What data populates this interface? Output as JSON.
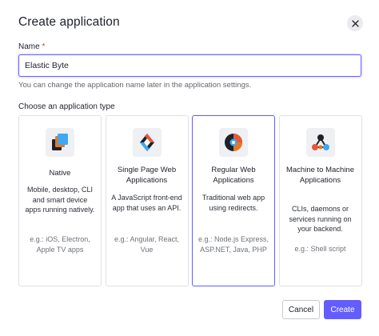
{
  "dialog": {
    "title": "Create application",
    "close_icon": "close-icon"
  },
  "name_field": {
    "label": "Name",
    "required_marker": "*",
    "value": "Elastic Byte",
    "helper": "You can change the application name later in the application settings."
  },
  "app_type": {
    "label": "Choose an application type",
    "selected": "Regular Web Applications",
    "options": [
      {
        "icon": "native-app-icon",
        "title": "Native",
        "description": "Mobile, desktop, CLI and smart device apps running natively.",
        "examples": "e.g.: iOS, Electron, Apple TV apps"
      },
      {
        "icon": "spa-icon",
        "title": "Single Page Web Applications",
        "description": "A JavaScript front-end app that uses an API.",
        "examples": "e.g.: Angular, React, Vue"
      },
      {
        "icon": "regular-web-app-icon",
        "title": "Regular Web Applications",
        "description": "Traditional web app using redirects.",
        "examples": "e.g.: Node.js Express, ASP.NET, Java, PHP"
      },
      {
        "icon": "m2m-icon",
        "title": "Machine to Machine Applications",
        "description": "CLIs, daemons or services running on your backend.",
        "examples": "e.g.: Shell script"
      }
    ]
  },
  "actions": {
    "cancel_label": "Cancel",
    "create_label": "Create"
  },
  "colors": {
    "accent": "#635dff",
    "border": "#dfe0e6"
  }
}
